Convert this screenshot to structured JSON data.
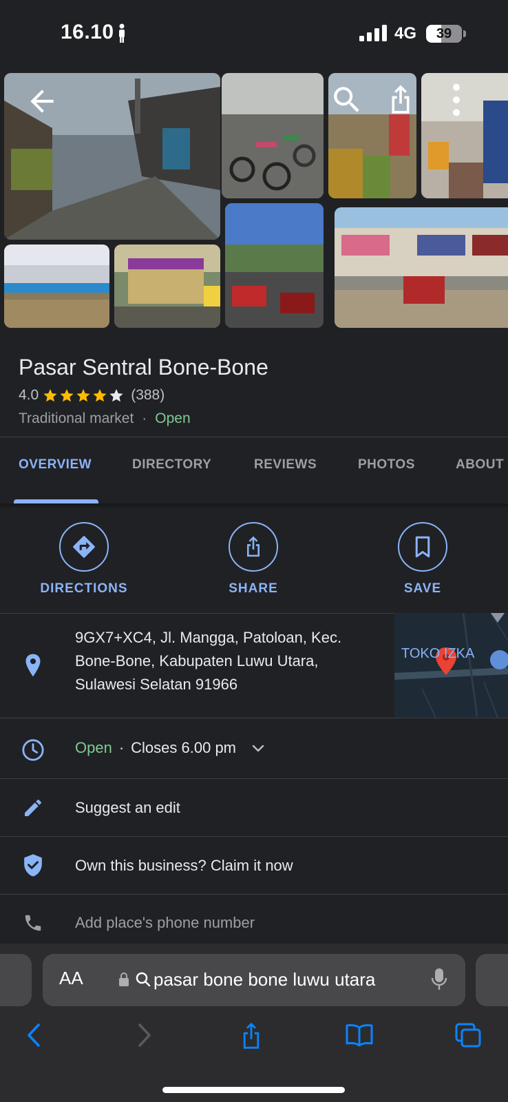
{
  "status_bar": {
    "time": "16.10",
    "network": "4G",
    "battery": "39"
  },
  "place": {
    "name": "Pasar Sentral Bone-Bone",
    "rating": "4.0",
    "stars": 4,
    "review_count": "(388)",
    "category": "Traditional market",
    "separator": "·",
    "status": "Open"
  },
  "tabs": [
    {
      "label": "OVERVIEW",
      "active": true
    },
    {
      "label": "DIRECTORY",
      "active": false
    },
    {
      "label": "REVIEWS",
      "active": false
    },
    {
      "label": "PHOTOS",
      "active": false
    },
    {
      "label": "ABOUT",
      "active": false
    }
  ],
  "actions": {
    "directions": "DIRECTIONS",
    "share": "SHARE",
    "save": "SAVE"
  },
  "info": {
    "address": "9GX7+XC4, Jl. Mangga, Patoloan, Kec. Bone-Bone, Kabupaten Luwu Utara, Sulawesi Selatan 91966",
    "map_label": "TOKO IZKA",
    "hours_status": "Open",
    "hours_separator": "·",
    "hours_detail": "Closes 6.00 pm",
    "suggest_edit": "Suggest an edit",
    "claim": "Own this business? Claim it now",
    "phone": "Add place's phone number"
  },
  "browser": {
    "aa_label": "AA",
    "url_text": "pasar bone bone luwu utara"
  },
  "colors": {
    "accent": "#8ab4f8",
    "open": "#81c995",
    "background": "#202124",
    "star": "#fbbc04"
  }
}
